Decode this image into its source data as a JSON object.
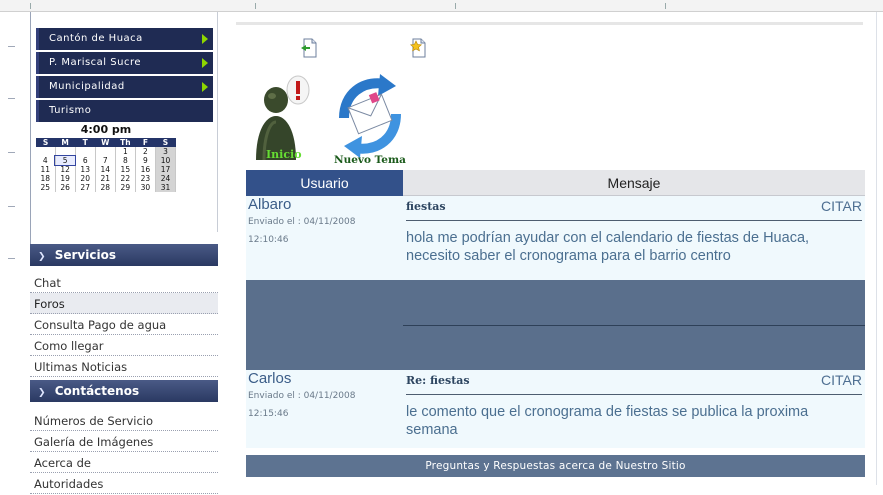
{
  "sidebar": {
    "menu_items": [
      {
        "label": "Cantón de Huaca",
        "has_arrow": true
      },
      {
        "label": "P. Mariscal Sucre",
        "has_arrow": true
      },
      {
        "label": "Municipalidad",
        "has_arrow": true
      },
      {
        "label": "Turismo",
        "has_arrow": false
      }
    ],
    "clock": "4:00 pm",
    "calendar": {
      "headers": [
        "S",
        "M",
        "T",
        "W",
        "Th",
        "F",
        "S"
      ],
      "weeks": [
        [
          "",
          "",
          "",
          "",
          "1",
          "2",
          "3"
        ],
        [
          "4",
          "5",
          "6",
          "7",
          "8",
          "9",
          "10"
        ],
        [
          "11",
          "12",
          "13",
          "14",
          "15",
          "16",
          "17"
        ],
        [
          "18",
          "19",
          "20",
          "21",
          "22",
          "23",
          "24"
        ],
        [
          "25",
          "26",
          "27",
          "28",
          "29",
          "30",
          "31"
        ]
      ],
      "today": "5"
    },
    "servicios": {
      "title": "Servicios",
      "items": [
        "Chat",
        "Foros",
        "Consulta Pago de agua",
        "Como llegar",
        "Ultimas Noticias"
      ],
      "active": "Foros"
    },
    "contactenos": {
      "title": "Contáctenos",
      "items": [
        "Números de Servicio",
        "Galería de Imágenes",
        "Acerca de",
        "Autoridades"
      ]
    }
  },
  "toolbar": {
    "inicio_label": "Inicio",
    "nuevo_tema_label": "Nuevo Tema"
  },
  "forum": {
    "col_user": "Usuario",
    "col_message": "Mensaje",
    "posts": [
      {
        "user": "Albaro",
        "sent_label": "Enviado el : 04/11/2008",
        "time": "12:10:46",
        "title": "fiestas",
        "quote": "CITAR",
        "body": "hola me podrían ayudar con el calendario de fiestas de Huaca, necesito saber el cronograma para el barrio centro"
      },
      {
        "user": "Carlos",
        "sent_label": "Enviado el : 04/11/2008",
        "time": "12:15:46",
        "title": "Re: fiestas",
        "quote": "CITAR",
        "body": "le comento que el cronograma de fiestas se publica la proxima semana"
      }
    ],
    "footer": "Preguntas y Respuestas acerca de Nuestro Sitio"
  },
  "colors": {
    "menu_bg": "#1f2b53",
    "menu_arrow": "#8ed600",
    "header_blue": "#33518a",
    "post_bg": "#f0f9fd",
    "separator_bg": "#5a6f8c"
  }
}
